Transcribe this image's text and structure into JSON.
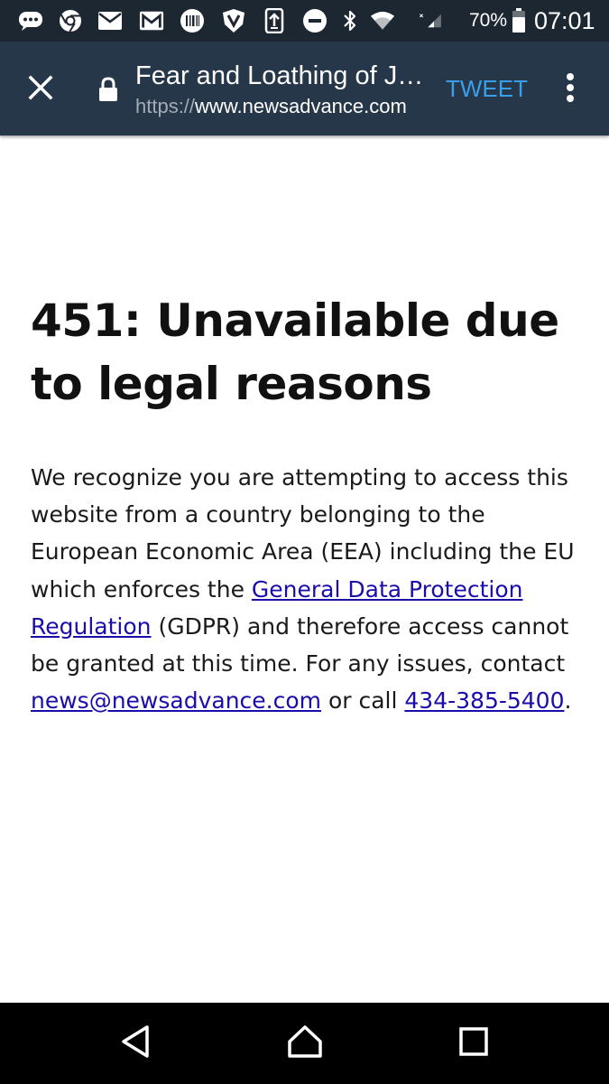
{
  "status_bar": {
    "battery_percent": "70%",
    "time": "07:01",
    "icons": [
      "chat-icon",
      "chrome-icon",
      "mail-icon",
      "gmail-icon",
      "barcode-icon",
      "shield-icon",
      "upload-icon",
      "do-not-disturb-icon",
      "bluetooth-icon",
      "wifi-icon",
      "signal-icon",
      "battery-icon"
    ]
  },
  "toolbar": {
    "title": "Fear and Loathing of J…",
    "url_scheme": "https://",
    "url_host": "www.newsadvance.com",
    "tweet_label": "TWEET",
    "icons": [
      "close-icon",
      "lock-icon",
      "more-vert-icon"
    ]
  },
  "main": {
    "heading": "451: Unavailable due to legal reasons",
    "body_part1": "We recognize you are attempting to access this website from a country belonging to the European Economic Area (EEA) including the EU which enforces the ",
    "gdpr_link": "General Data Protection Regulation",
    "body_part2": " (GDPR) and therefore access cannot be granted at this time. For any issues, contact ",
    "email_link": "news@newsadvance.com",
    "body_part3": " or call ",
    "phone_link": "434-385-5400",
    "body_part4": "."
  },
  "nav_bar": {
    "icons": [
      "back-icon",
      "home-icon",
      "recents-icon"
    ]
  },
  "colors": {
    "status_bar_bg": "#1d2732",
    "toolbar_bg": "#26374a",
    "tweet_accent": "#3a9ee8",
    "link": "#1a0dab"
  }
}
